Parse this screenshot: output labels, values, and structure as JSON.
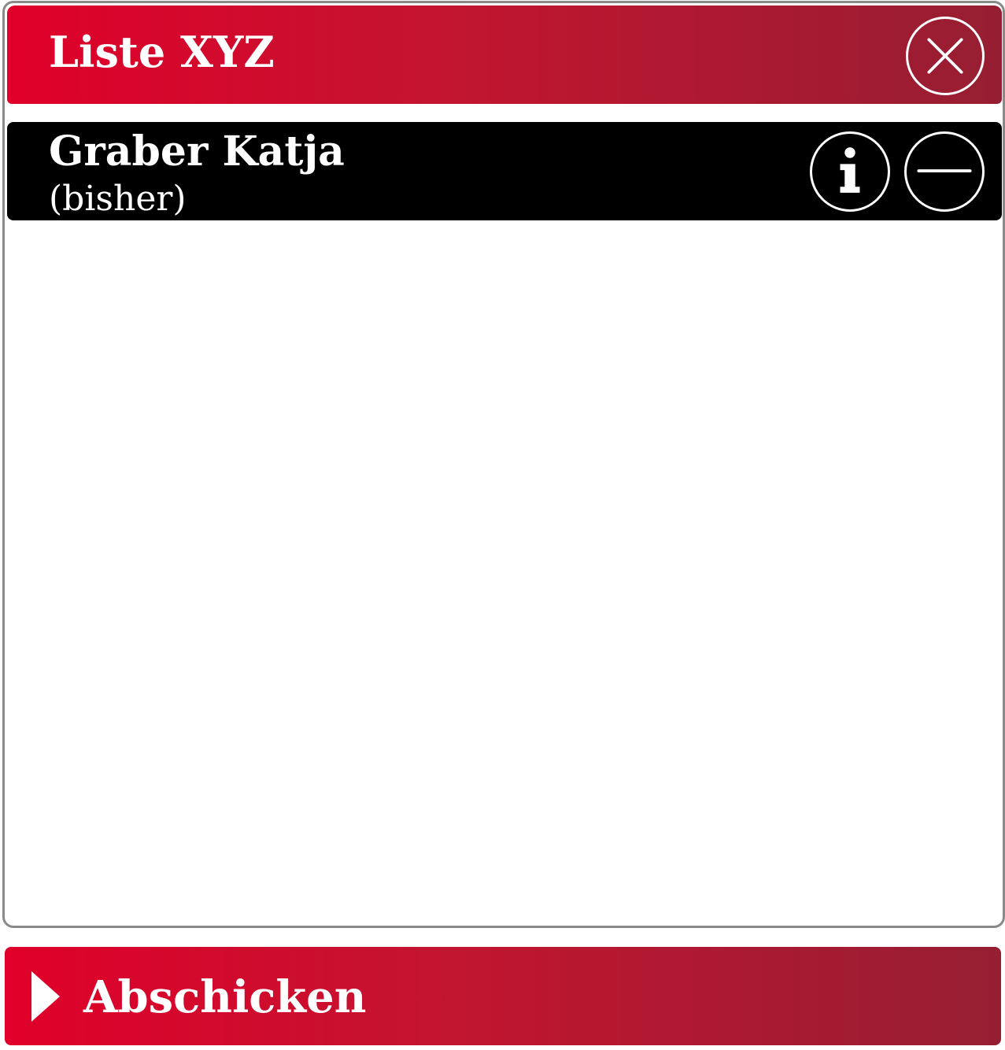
{
  "header": {
    "title": "Liste XYZ",
    "close_icon": "close-icon"
  },
  "list": {
    "items": [
      {
        "name": "Graber Katja",
        "status": "(bisher)",
        "info_icon": "info-icon",
        "remove_icon": "minus-icon"
      }
    ]
  },
  "footer": {
    "submit_label": "Abschicken",
    "submit_icon": "play-icon"
  },
  "colors": {
    "accent_start": "#e0002a",
    "accent_end": "#961e32",
    "row_background": "#000000",
    "border": "#8a8a8a",
    "text_on_accent": "#ffffff"
  }
}
